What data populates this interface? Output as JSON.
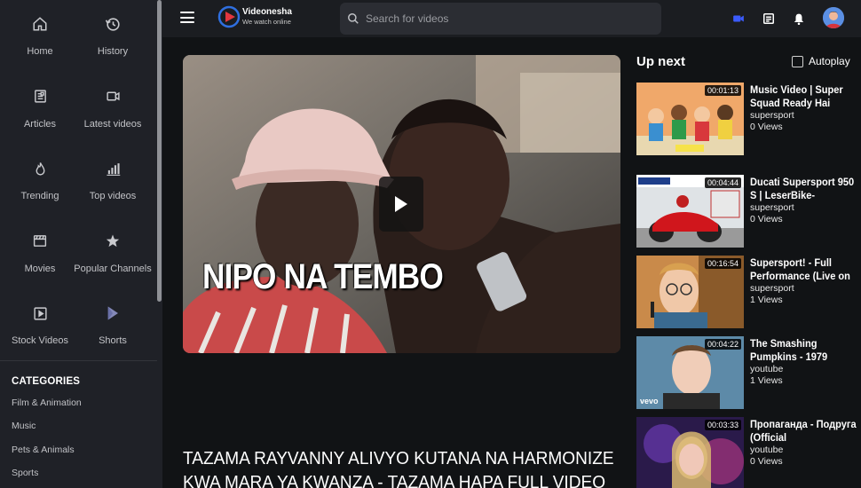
{
  "brand": {
    "name": "Videonesha",
    "tagline": "We watch online"
  },
  "search": {
    "placeholder": "Search for videos"
  },
  "sidebar": {
    "nav": [
      {
        "label": "Home",
        "icon": "home-icon"
      },
      {
        "label": "History",
        "icon": "history-icon"
      },
      {
        "label": "Articles",
        "icon": "article-icon"
      },
      {
        "label": "Latest videos",
        "icon": "video-camera-icon"
      },
      {
        "label": "Trending",
        "icon": "flame-icon"
      },
      {
        "label": "Top videos",
        "icon": "bar-chart-icon"
      },
      {
        "label": "Movies",
        "icon": "clapperboard-icon"
      },
      {
        "label": "Popular Channels",
        "icon": "star-badge-icon"
      },
      {
        "label": "Stock Videos",
        "icon": "play-square-icon"
      },
      {
        "label": "Shorts",
        "icon": "shorts-icon"
      }
    ],
    "categories_title": "CATEGORIES",
    "categories": [
      "Film & Animation",
      "Music",
      "Pets & Animals",
      "Sports"
    ]
  },
  "player": {
    "overlay_text": "NIPO NA TEMBO",
    "title": "TAZAMA RAYVANNY ALIVYO KUTANA NA HARMONIZE",
    "title_line2": "KWA MARA YA KWANZA - TAZAMA HAPA FULL VIDEO"
  },
  "upnext": {
    "heading": "Up next",
    "autoplay_label": "Autoplay",
    "items": [
      {
        "title": "Music Video | Super Squad Ready Hai",
        "channel": "supersport",
        "views": "0 Views",
        "duration": "00:01:13"
      },
      {
        "title": "Ducati Supersport 950 S | LeserBike-",
        "channel": "supersport",
        "views": "0 Views",
        "duration": "00:04:44"
      },
      {
        "title": "Supersport! - Full Performance (Live on",
        "channel": "supersport",
        "views": "1 Views",
        "duration": "00:16:54"
      },
      {
        "title": "The Smashing Pumpkins - 1979",
        "channel": "youtube",
        "views": "1 Views",
        "duration": "00:04:22"
      },
      {
        "title": "Пропаганда - Подруга (Official",
        "channel": "youtube",
        "views": "0 Views",
        "duration": "00:03:33"
      }
    ]
  },
  "colors": {
    "accent": "#3b5bfd",
    "sidebar_bg": "#1f2127",
    "page_bg": "#111315"
  }
}
